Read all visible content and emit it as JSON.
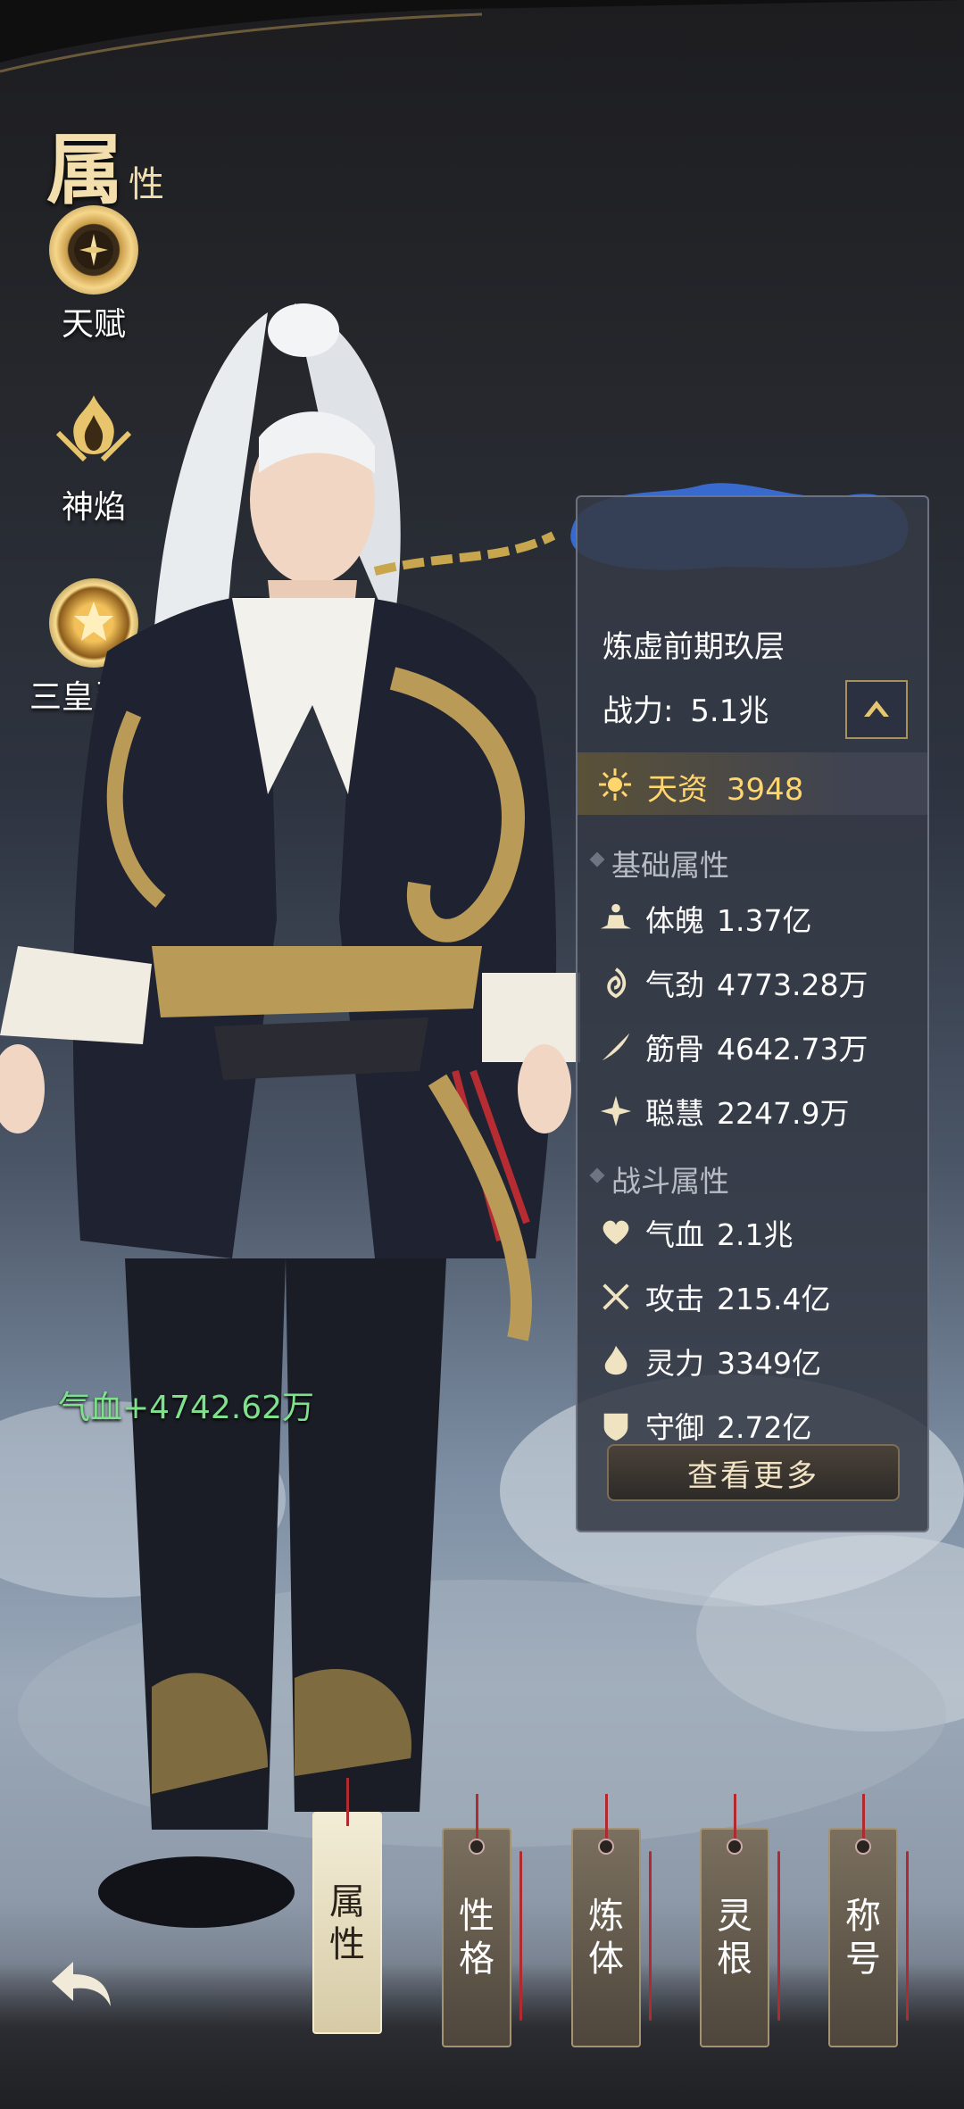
{
  "page": {
    "title_big": "属",
    "title_small": "性"
  },
  "side_menu": [
    {
      "label": "天赋",
      "icon": "talent-icon"
    },
    {
      "label": "神焰",
      "icon": "divine-flame-icon"
    },
    {
      "label": "三皇灵威",
      "icon": "three-sovereigns-icon"
    }
  ],
  "floating_text": "气血+4742.62万",
  "panel": {
    "realm": "炼虚前期玖层",
    "power_label": "战力:",
    "power_value": "5.1兆",
    "talent_label": "天资",
    "talent_value": "3948",
    "basic_section": "基础属性",
    "basic": [
      {
        "label": "体魄",
        "value": "1.37亿",
        "icon": "meditation-icon"
      },
      {
        "label": "气劲",
        "value": "4773.28万",
        "icon": "qi-swirl-icon"
      },
      {
        "label": "筋骨",
        "value": "4642.73万",
        "icon": "feather-icon"
      },
      {
        "label": "聪慧",
        "value": "2247.9万",
        "icon": "sparkle-icon"
      }
    ],
    "combat_section": "战斗属性",
    "combat": [
      {
        "label": "气血",
        "value": "2.1兆",
        "icon": "heart-icon"
      },
      {
        "label": "攻击",
        "value": "215.4亿",
        "icon": "crossed-swords-icon"
      },
      {
        "label": "灵力",
        "value": "3349亿",
        "icon": "spirit-flame-icon"
      },
      {
        "label": "守御",
        "value": "2.72亿",
        "icon": "shield-icon"
      }
    ],
    "more_button": "查看更多"
  },
  "tabs": [
    {
      "label_top": "属",
      "label_bottom": "性",
      "active": true
    },
    {
      "label_top": "性",
      "label_bottom": "格",
      "active": false
    },
    {
      "label_top": "炼",
      "label_bottom": "体",
      "active": false
    },
    {
      "label_top": "灵",
      "label_bottom": "根",
      "active": false
    },
    {
      "label_top": "称",
      "label_bottom": "号",
      "active": false
    }
  ],
  "colors": {
    "gold": "#ffd56d",
    "panel": "#343a46",
    "heal_green": "#7ee28c",
    "tab_string": "#b02a30"
  }
}
